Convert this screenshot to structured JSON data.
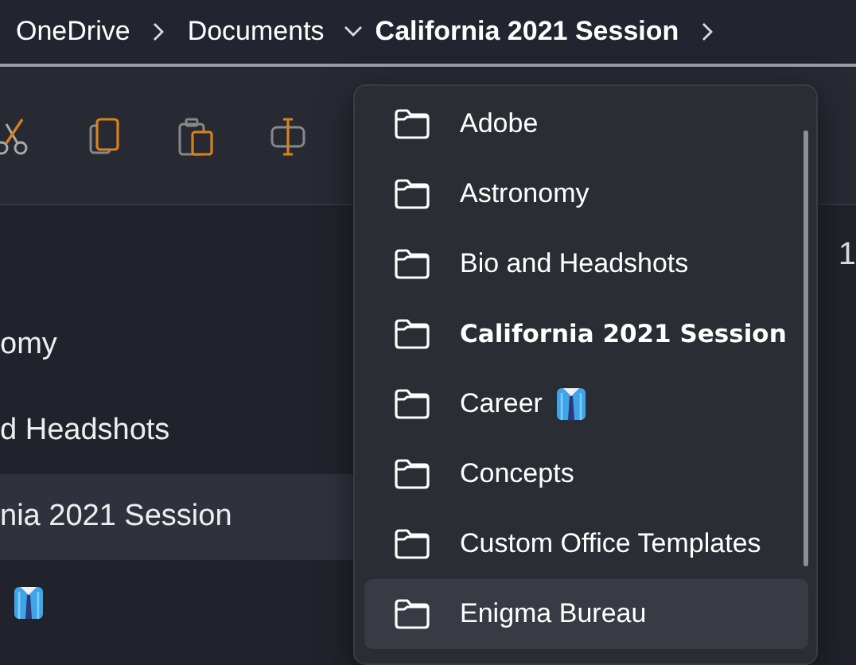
{
  "breadcrumb": [
    {
      "label": "OneDrive",
      "current": false,
      "expanded": false
    },
    {
      "label": "Documents",
      "current": false,
      "expanded": true
    },
    {
      "label": "California 2021 Session",
      "current": true,
      "expanded": false
    }
  ],
  "toolbar": {
    "buttons": [
      {
        "kind": "cut"
      },
      {
        "kind": "copy"
      },
      {
        "kind": "paste"
      },
      {
        "kind": "rename"
      }
    ]
  },
  "file_list": {
    "items": [
      {
        "label": "omy",
        "selected": false,
        "tie_badge": false
      },
      {
        "label": "d Headshots",
        "selected": false,
        "tie_badge": false
      },
      {
        "label": "nia 2021 Session",
        "selected": true,
        "tie_badge": false
      },
      {
        "selected": false,
        "tie_badge": true
      }
    ]
  },
  "details_pane": {
    "text": "1"
  },
  "folder_menu": {
    "items": [
      {
        "label": "Adobe",
        "selected": false,
        "hovered": false,
        "tie_badge": false
      },
      {
        "label": "Astronomy",
        "selected": false,
        "hovered": false,
        "tie_badge": false
      },
      {
        "label": "Bio and Headshots",
        "selected": false,
        "hovered": false,
        "tie_badge": false
      },
      {
        "label": "California 2021 Session",
        "selected": true,
        "hovered": false,
        "tie_badge": false
      },
      {
        "label": "Career",
        "selected": false,
        "hovered": false,
        "tie_badge": true
      },
      {
        "label": "Concepts",
        "selected": false,
        "hovered": false,
        "tie_badge": false
      },
      {
        "label": "Custom Office Templates",
        "selected": false,
        "hovered": false,
        "tie_badge": false
      },
      {
        "label": "Enigma Bureau",
        "selected": false,
        "hovered": true,
        "tie_badge": false
      }
    ]
  }
}
